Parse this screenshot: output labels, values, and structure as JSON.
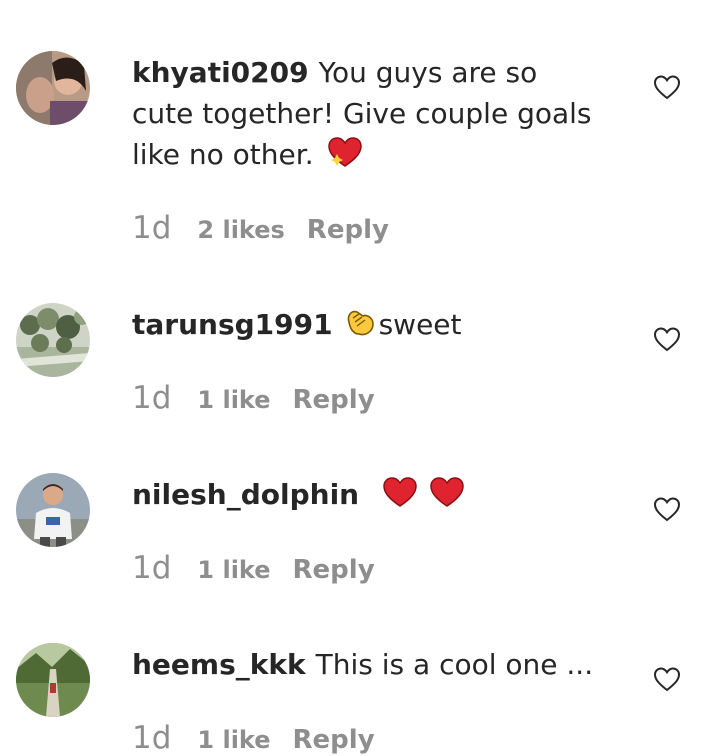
{
  "comments": [
    {
      "username": "khyati0209",
      "text": "You guys are so cute together! Give couple goals like no other.",
      "emoji": "sparkling-heart",
      "time": "1d",
      "likes": "2 likes",
      "reply": "Reply"
    },
    {
      "username": "tarunsg1991",
      "text": "sweet",
      "emoji": "clapping-hands",
      "time": "1d",
      "likes": "1 like",
      "reply": "Reply"
    },
    {
      "username": "nilesh_dolphin",
      "text": "",
      "emoji": "two-red-hearts",
      "time": "1d",
      "likes": "1 like",
      "reply": "Reply"
    },
    {
      "username": "heems_kkk",
      "text": "This is a cool one ...",
      "emoji": "",
      "time": "1d",
      "likes": "1 like",
      "reply": "Reply"
    }
  ],
  "colors": {
    "text": "#262626",
    "meta": "#8e8e8e",
    "heart_red": "#e0242f"
  }
}
